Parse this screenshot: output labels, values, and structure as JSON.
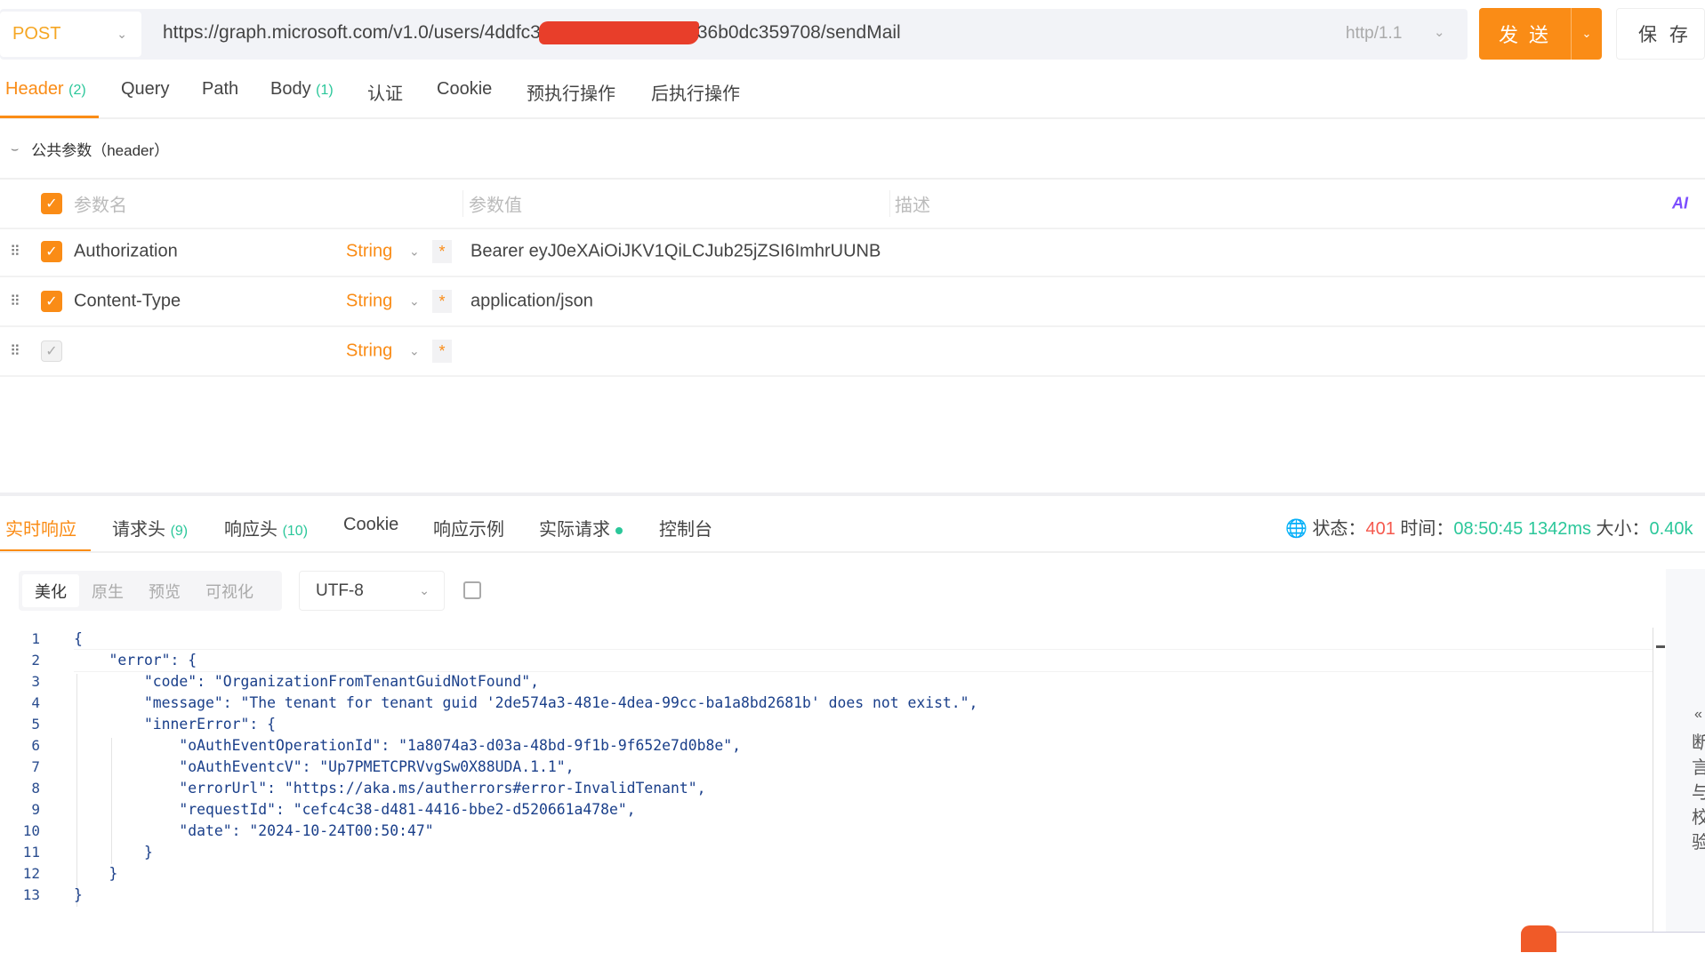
{
  "request": {
    "method": "POST",
    "url_prefix": "https://graph.microsoft.com/v1.0/users/4ddfc3",
    "url_suffix": "36b0dc359708/sendMail",
    "http_version": "http/1.1",
    "send_label": "发 送",
    "save_label": "保 存"
  },
  "request_tabs": [
    {
      "label": "Header",
      "count": "(2)"
    },
    {
      "label": "Query",
      "count": ""
    },
    {
      "label": "Path",
      "count": ""
    },
    {
      "label": "Body",
      "count": "(1)"
    },
    {
      "label": "认证",
      "count": ""
    },
    {
      "label": "Cookie",
      "count": ""
    },
    {
      "label": "预执行操作",
      "count": ""
    },
    {
      "label": "后执行操作",
      "count": ""
    }
  ],
  "public_params": "公共参数（header）",
  "params_table": {
    "headers": {
      "name": "参数名",
      "value": "参数值",
      "desc": "描述"
    },
    "ai_label": "AI",
    "rows": [
      {
        "name": "Authorization",
        "type": "String",
        "value": "Bearer eyJ0eXAiOiJKV1QiLCJub25jZSI6ImhrUUNB",
        "checked": true
      },
      {
        "name": "Content-Type",
        "type": "String",
        "value": "application/json",
        "checked": true
      },
      {
        "name": "",
        "type": "String",
        "value": "",
        "checked": false
      }
    ]
  },
  "response_tabs": [
    {
      "label": "实时响应",
      "count": ""
    },
    {
      "label": "请求头",
      "count": "(9)"
    },
    {
      "label": "响应头",
      "count": "(10)"
    },
    {
      "label": "Cookie",
      "count": ""
    },
    {
      "label": "响应示例",
      "count": ""
    },
    {
      "label": "实际请求",
      "count": ""
    },
    {
      "label": "控制台",
      "count": ""
    }
  ],
  "status": {
    "status_label": "状态：",
    "status_code": "401",
    "time_label": "时间：",
    "time": "08:50:45",
    "duration": "1342ms",
    "size_label": "大小：",
    "size": "0.40k"
  },
  "view_modes": [
    "美化",
    "原生",
    "预览",
    "可视化"
  ],
  "encoding": "UTF-8",
  "code_lines": [
    "{",
    "    \"error\": {",
    "        \"code\": \"OrganizationFromTenantGuidNotFound\",",
    "        \"message\": \"The tenant for tenant guid '2de574a3-481e-4dea-99cc-ba1a8bd2681b' does not exist.\",",
    "        \"innerError\": {",
    "            \"oAuthEventOperationId\": \"1a8074a3-d03a-48bd-9f1b-9f652e7d0b8e\",",
    "            \"oAuthEventcV\": \"Up7PMETCPRVvgSw0X88UDA.1.1\",",
    "            \"errorUrl\": \"https://aka.ms/autherrors#error-InvalidTenant\",",
    "            \"requestId\": \"cefc4c38-d481-4416-bbe2-d520661a478e\",",
    "            \"date\": \"2024-10-24T00:50:47\"",
    "        }",
    "    }",
    "}"
  ],
  "side_panel": {
    "label": "断言与校验"
  },
  "colors": {
    "accent": "#fa8c16",
    "success": "#2bc79a",
    "error": "#f5594e"
  }
}
